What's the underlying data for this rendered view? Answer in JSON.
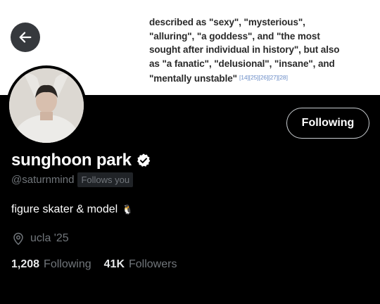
{
  "banner": {
    "lines": [
      "described as \"sexy\", \"mysterious\",",
      "\"alluring\", \"a goddess\", and \"the most",
      "sought after individual in history\", but also",
      "as  \"a fanatic\", \"delusional\", \"insane\", and",
      "\"mentally unstable\""
    ],
    "refs": "[14][25][26][27][28]"
  },
  "header": {
    "back_icon": "arrow-left-icon"
  },
  "profile": {
    "display_name": "sunghoon park",
    "verified": true,
    "handle": "@saturnmind",
    "follows_you": "Follows you",
    "bio": "figure skater & model",
    "bio_emoji": "🐧",
    "location": "ucla '25",
    "following_count": "1,208",
    "following_label": "Following",
    "followers_count": "41K",
    "followers_label": "Followers"
  },
  "actions": {
    "follow_button": "Following"
  },
  "colors": {
    "background": "#000000",
    "muted": "#71767b",
    "banner": "#ffffff"
  }
}
